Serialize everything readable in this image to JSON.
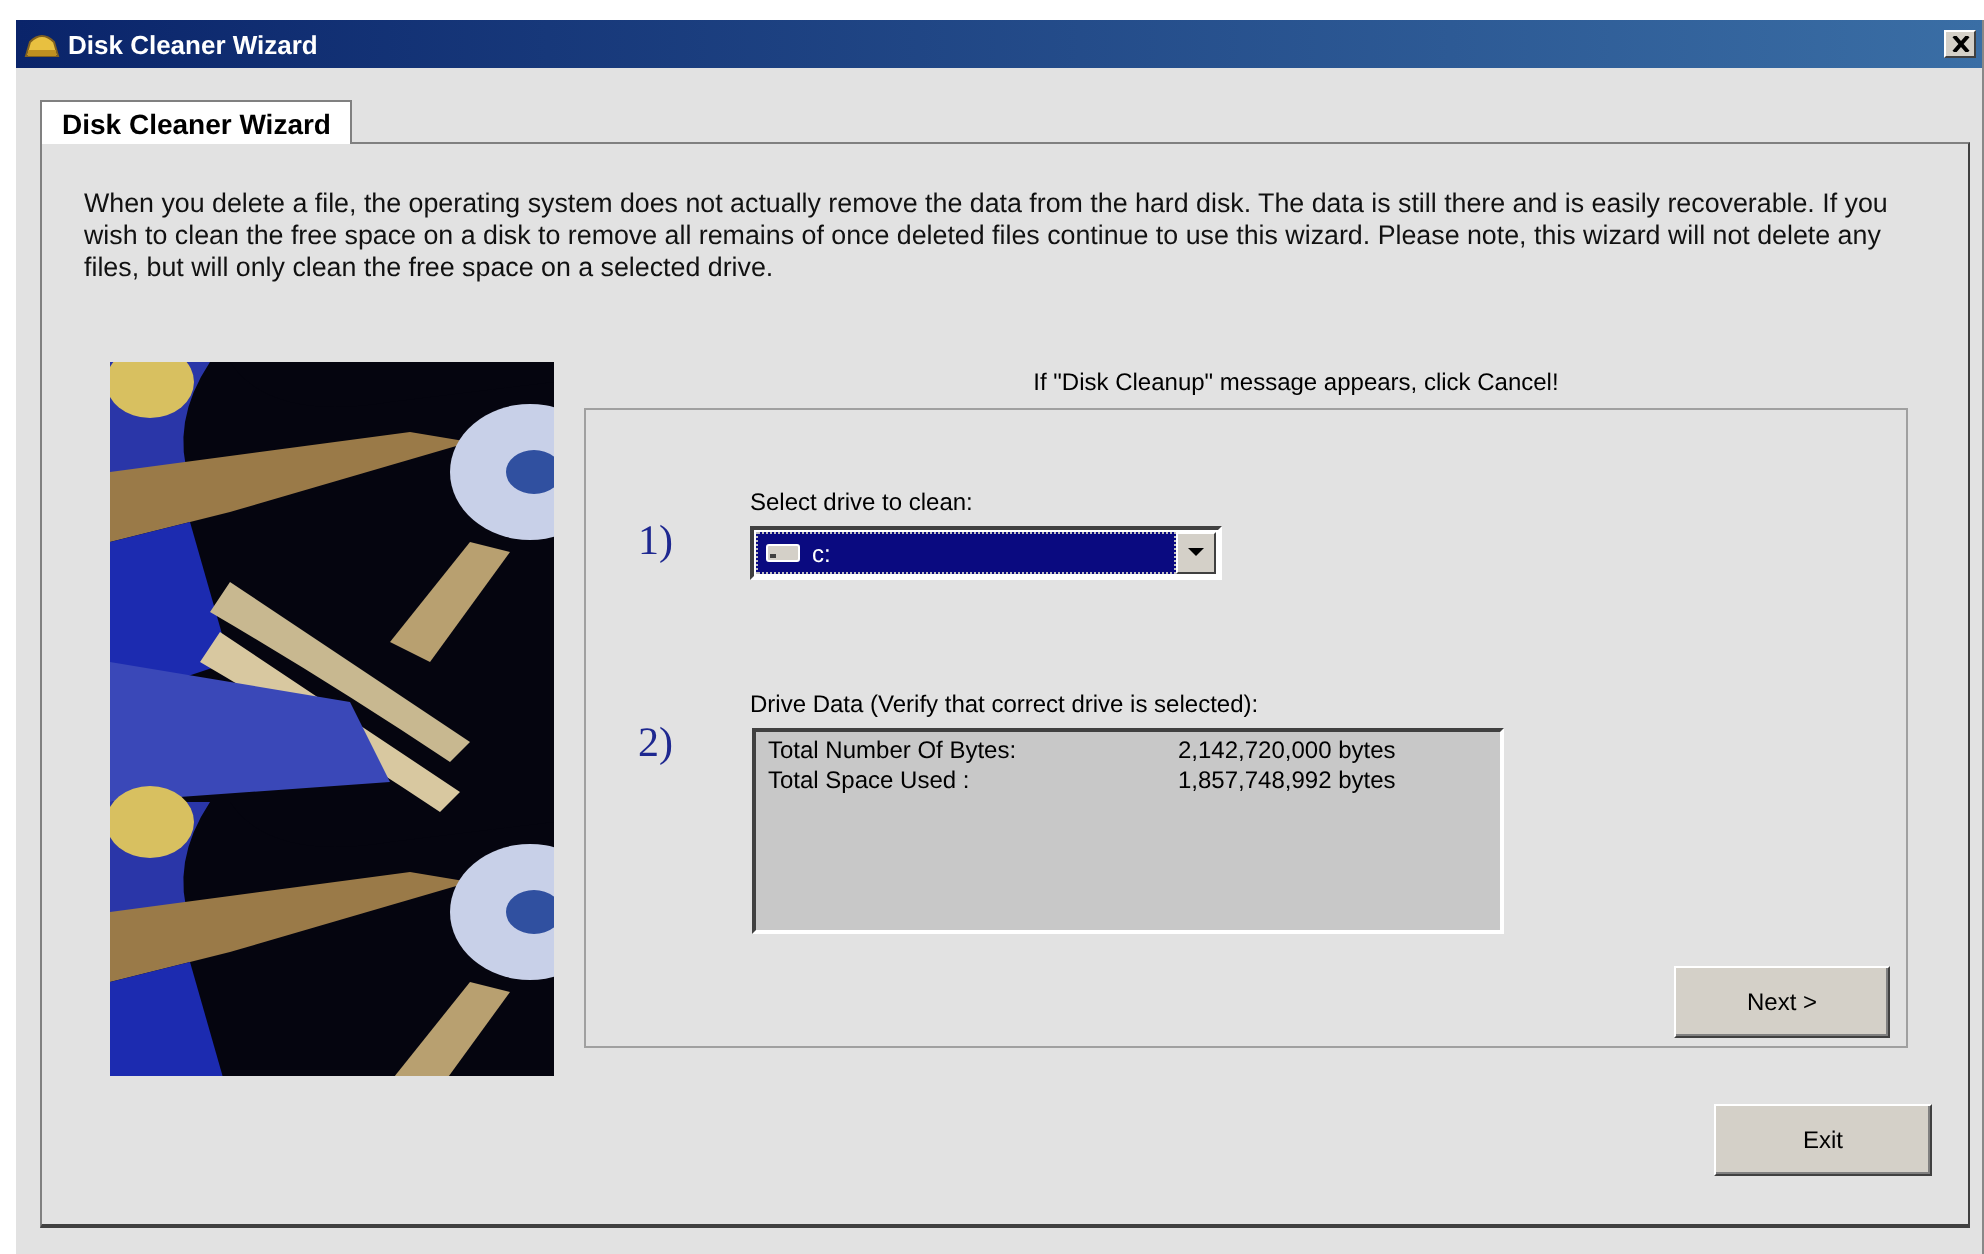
{
  "window": {
    "title": "Disk Cleaner Wizard"
  },
  "tabs": [
    {
      "label": "Disk Cleaner Wizard",
      "selected": true
    }
  ],
  "intro": "When you delete a file, the operating system does not actually remove the data from the hard disk. The data is still there and is easily recoverable. If you wish to clean the free space on a disk to remove all remains of once deleted files continue to use this wizard. Please note, this wizard will not delete any files, but will only clean the free space on a selected drive.",
  "notice": "If \"Disk Cleanup\" message appears, click Cancel!",
  "steps": [
    {
      "number": "1)",
      "label": "Select drive to clean:",
      "kind": "dropdown",
      "value": "c:"
    },
    {
      "number": "2)",
      "label": "Drive Data (Verify that correct drive is selected):",
      "kind": "listbox",
      "rows": [
        {
          "name": "Total Number Of Bytes:",
          "value": "2,142,720,000 bytes"
        },
        {
          "name": "Total Space Used :",
          "value": "1,857,748,992 bytes"
        }
      ]
    }
  ],
  "next_button": "Next >",
  "exit_button": "Exit"
}
